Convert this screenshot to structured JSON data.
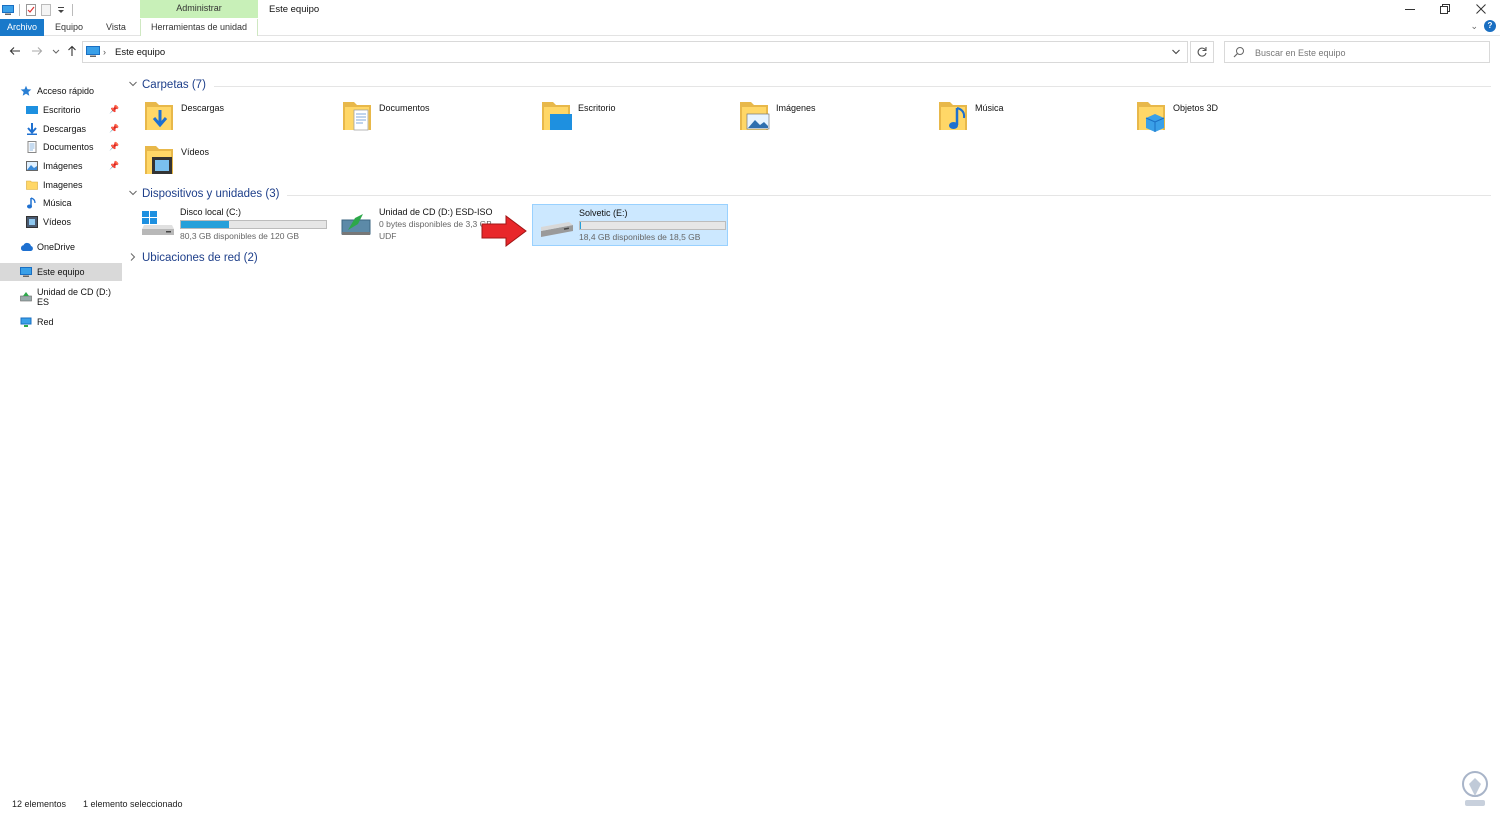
{
  "window": {
    "title": "Este equipo",
    "context_tab_header": "Administrar"
  },
  "ribbon": {
    "tabs": [
      "Archivo",
      "Equipo",
      "Vista",
      "Herramientas de unidad"
    ]
  },
  "address": {
    "separator": "›",
    "path": "Este equipo",
    "search_placeholder": "Buscar en Este equipo"
  },
  "nav": {
    "quick_access": "Acceso rápido",
    "items": [
      {
        "label": "Escritorio",
        "pinned": true
      },
      {
        "label": "Descargas",
        "pinned": true
      },
      {
        "label": "Documentos",
        "pinned": true
      },
      {
        "label": "Imágenes",
        "pinned": true
      },
      {
        "label": "Imagenes",
        "pinned": false
      },
      {
        "label": "Música",
        "pinned": false
      },
      {
        "label": "Vídeos",
        "pinned": false
      }
    ],
    "onedrive": "OneDrive",
    "this_pc": "Este equipo",
    "cd_drive": "Unidad de CD (D:) ES",
    "network": "Red"
  },
  "groups": {
    "folders": "Carpetas (7)",
    "devices": "Dispositivos y unidades (3)",
    "network": "Ubicaciones de red (2)"
  },
  "folders": [
    {
      "name": "Descargas",
      "icon": "downloads-folder-icon"
    },
    {
      "name": "Documentos",
      "icon": "documents-folder-icon"
    },
    {
      "name": "Escritorio",
      "icon": "desktop-folder-icon"
    },
    {
      "name": "Imágenes",
      "icon": "pictures-folder-icon"
    },
    {
      "name": "Música",
      "icon": "music-folder-icon"
    },
    {
      "name": "Objetos 3D",
      "icon": "3d-objects-folder-icon"
    },
    {
      "name": "Vídeos",
      "icon": "videos-folder-icon"
    }
  ],
  "drives": [
    {
      "name": "Disco local (C:)",
      "free_text": "80,3 GB disponibles de 120 GB",
      "used_fraction": 0.33
    },
    {
      "name": "Unidad de CD (D:) ESD-ISO",
      "free_text": "0 bytes disponibles de 3,3 GB",
      "fs": "UDF"
    },
    {
      "name": "Solvetic (E:)",
      "free_text": "18,4 GB disponibles de 18,5 GB",
      "used_fraction": 0.005,
      "selected": true
    }
  ],
  "status": {
    "count": "12 elementos",
    "selected": "1 elemento seleccionado"
  },
  "colors": {
    "accent": "#1979ca",
    "selection": "#cce8ff",
    "group_title": "#1e3f8a",
    "drive_bar": "#26a0da",
    "arrow": "#e8272a"
  }
}
